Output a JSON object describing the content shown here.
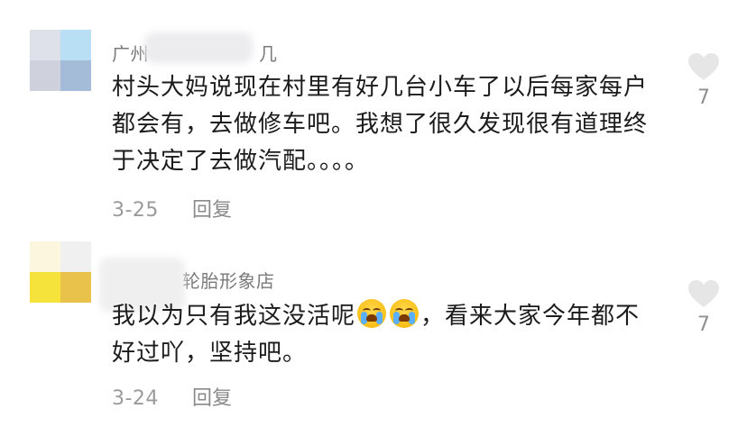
{
  "comments": [
    {
      "username_prefix": "广州",
      "username_suffix": "几",
      "text": "村头大妈说现在村里有好几台小车了以后每家每户都会有，去做修车吧。我想了很久发现很有道理终于决定了去做汽配。。。。",
      "date": "3-25",
      "reply_label": "回复",
      "like_count": "7",
      "avatar_colors": [
        "#dfe1ea",
        "#b8dff3",
        "#cfd1dd",
        "#a5bcd8"
      ]
    },
    {
      "username_prefix": "",
      "username_suffix": "轮胎形象店",
      "text_before": "我以为只有我这没活呢",
      "text_after": "，看来大家今年都不好过吖，坚持吧。",
      "emoji_name": "loudly-crying-face",
      "date": "3-24",
      "reply_label": "回复",
      "like_count": "7",
      "avatar_colors": [
        "#fbf6dd",
        "#f0f0f0",
        "#f5e23a",
        "#e8c24a"
      ]
    }
  ],
  "colors": {
    "heart": "#e6e6e6",
    "meta_text": "#9b9b9b",
    "body_text": "#1b1b1b"
  }
}
